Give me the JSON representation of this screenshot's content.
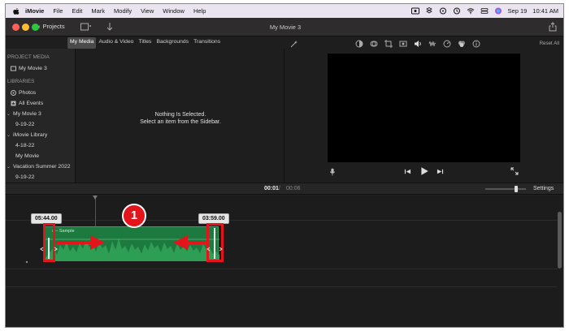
{
  "menubar": {
    "apple_icon": "apple-logo-icon",
    "menus": [
      "iMovie",
      "File",
      "Edit",
      "Mark",
      "Modify",
      "View",
      "Window",
      "Help"
    ],
    "date": "Sep 19",
    "time": "10:41 AM"
  },
  "titlebar": {
    "projects_label": "Projects",
    "window_title": "My Movie 3"
  },
  "tabs": [
    "My Media",
    "Audio & Video",
    "Titles",
    "Backgrounds",
    "Transitions"
  ],
  "sidebar": {
    "project_media_header": "PROJECT MEDIA",
    "project_item": "My Movie 3",
    "libraries_header": "LIBRARIES",
    "items": [
      {
        "label": "Photos"
      },
      {
        "label": "All Events"
      },
      {
        "label": "My Movie 3"
      },
      {
        "label": "9-19-22"
      },
      {
        "label": "iMovie Library"
      },
      {
        "label": "4-18-22"
      },
      {
        "label": "My Movie"
      },
      {
        "label": "Vacation Summer 2022"
      },
      {
        "label": "9-19-22"
      }
    ]
  },
  "media": {
    "empty_line1": "Nothing Is Selected.",
    "empty_line2": "Select an item from the Sidebar."
  },
  "viewer": {
    "reset_all": "Reset All"
  },
  "timeline": {
    "current_time": "00:01",
    "separator": "/",
    "duration": "00:06",
    "settings_label": "Settings",
    "zoom_level": 0.76,
    "clip_title": "s – Sample",
    "left_timecode": "05:44.00",
    "right_timecode": "03:59.00",
    "step_number": "1"
  },
  "colors": {
    "clip_green": "#1d7a3f",
    "annotation_red": "#e3141b"
  }
}
